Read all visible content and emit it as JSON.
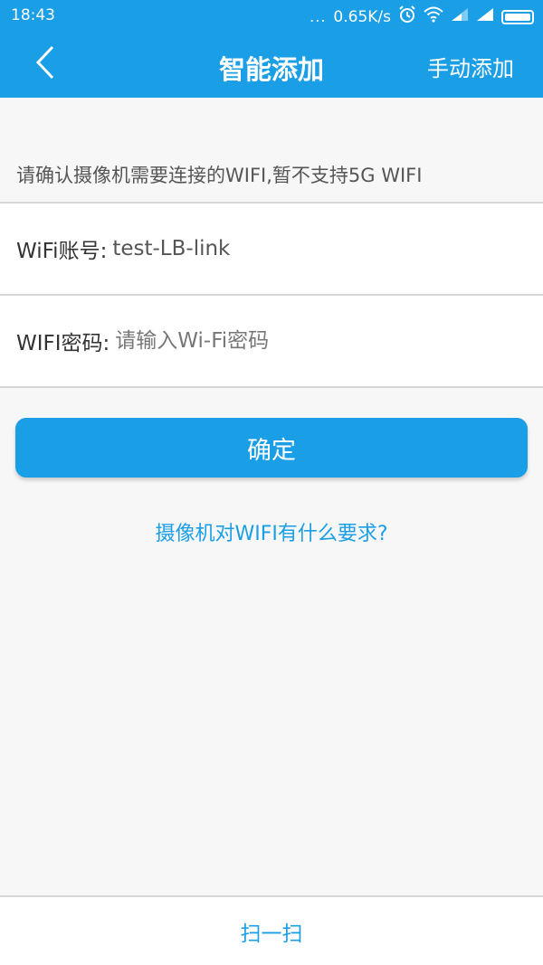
{
  "status_bar": {
    "time": "18:43",
    "dots": "...",
    "speed": "0.65K/s",
    "icons": [
      "alarm-icon",
      "wifi-icon",
      "signal-icon",
      "signal-icon",
      "battery-icon"
    ]
  },
  "header": {
    "back_icon": "chevron-left-icon",
    "title": "智能添加",
    "manual_add": "手动添加"
  },
  "form": {
    "hint": "请确认摄像机需要连接的WIFI,暂不支持5G WIFI",
    "wifi_account_label": "WiFi账号:",
    "wifi_account_value": "test-LB-link",
    "wifi_password_label": "WIFI密码:",
    "wifi_password_placeholder": "请输入Wi-Fi密码",
    "wifi_password_value": ""
  },
  "actions": {
    "confirm": "确定",
    "help_link": "摄像机对WIFI有什么要求?",
    "scan": "扫一扫"
  },
  "colors": {
    "primary": "#1a9ee6",
    "background": "#f7f7f7",
    "divider": "#d6d6d6"
  }
}
